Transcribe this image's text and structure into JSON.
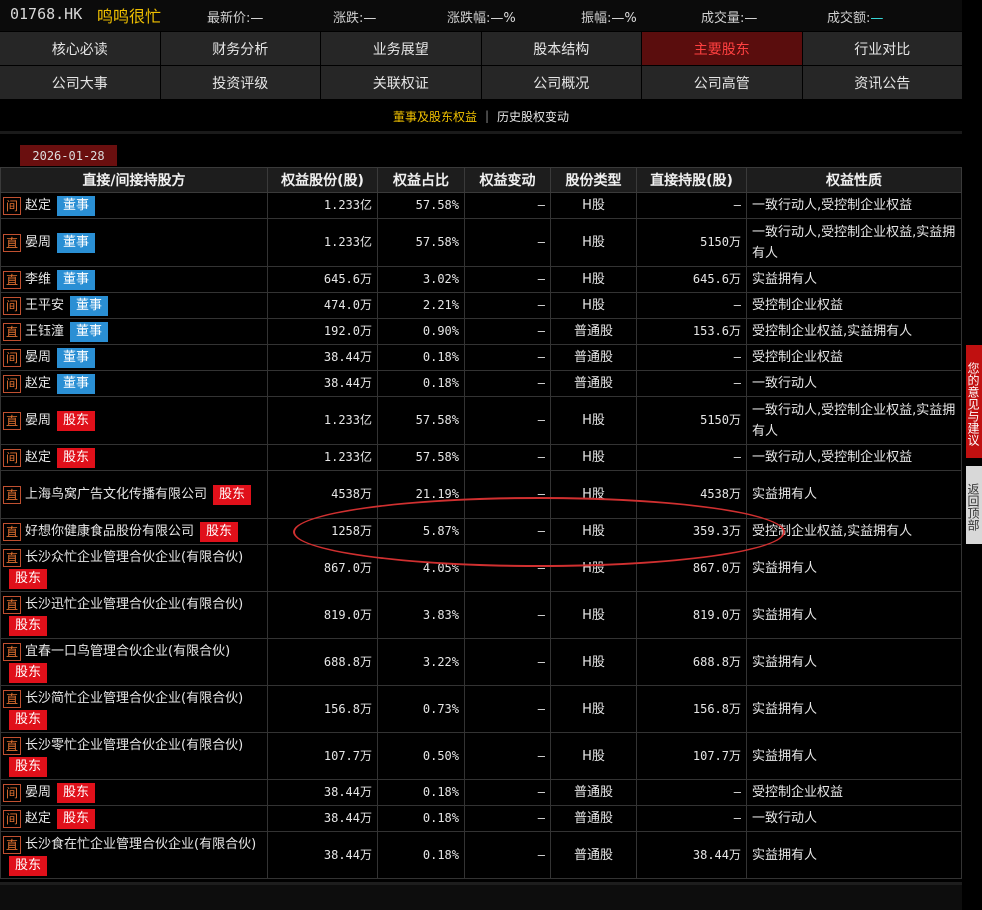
{
  "header": {
    "code": "01768.HK",
    "name": "鸣鸣很忙",
    "quotes": [
      {
        "label": "最新价:",
        "value": "—",
        "color": "#dddddd"
      },
      {
        "label": "涨跌:",
        "value": "—",
        "color": "#dddddd"
      },
      {
        "label": "涨跌幅:",
        "value": "—%",
        "color": "#dddddd"
      },
      {
        "label": "振幅:",
        "value": "—%",
        "color": "#dddddd"
      },
      {
        "label": "成交量:",
        "value": "—",
        "color": "#dddddd"
      },
      {
        "label": "成交额:",
        "value": "—",
        "color": "#39e0e0"
      }
    ]
  },
  "nav": {
    "row1": [
      "核心必读",
      "财务分析",
      "业务展望",
      "股本结构",
      "主要股东",
      "行业对比"
    ],
    "row2": [
      "公司大事",
      "投资评级",
      "关联权证",
      "公司概况",
      "公司高管",
      "资讯公告"
    ],
    "active": "主要股东"
  },
  "subnav": {
    "active": "董事及股东权益",
    "separator": "|",
    "other": "历史股权变动"
  },
  "date": "2026-01-28",
  "table": {
    "headers": [
      "直接/间接持股方",
      "权益股份(股)",
      "权益占比",
      "权益变动",
      "股份类型",
      "直接持股(股)",
      "权益性质"
    ],
    "rows": [
      {
        "flag": "间",
        "name": "赵定",
        "role": "董事",
        "role_type": "director",
        "shares": "1.233亿",
        "ratio": "57.58%",
        "change": "—",
        "type": "H股",
        "direct": "—",
        "nature": "一致行动人,受控制企业权益"
      },
      {
        "flag": "直",
        "name": "晏周",
        "role": "董事",
        "role_type": "director",
        "shares": "1.233亿",
        "ratio": "57.58%",
        "change": "—",
        "type": "H股",
        "direct": "5150万",
        "nature": "一致行动人,受控制企业权益,实益拥有人"
      },
      {
        "flag": "直",
        "name": "李维",
        "role": "董事",
        "role_type": "director",
        "shares": "645.6万",
        "ratio": "3.02%",
        "change": "—",
        "type": "H股",
        "direct": "645.6万",
        "nature": "实益拥有人"
      },
      {
        "flag": "间",
        "name": "王平安",
        "role": "董事",
        "role_type": "director",
        "shares": "474.0万",
        "ratio": "2.21%",
        "change": "—",
        "type": "H股",
        "direct": "—",
        "nature": "受控制企业权益"
      },
      {
        "flag": "直",
        "name": "王钰潼",
        "role": "董事",
        "role_type": "director",
        "shares": "192.0万",
        "ratio": "0.90%",
        "change": "—",
        "type": "普通股",
        "direct": "153.6万",
        "nature": "受控制企业权益,实益拥有人"
      },
      {
        "flag": "间",
        "name": "晏周",
        "role": "董事",
        "role_type": "director",
        "shares": "38.44万",
        "ratio": "0.18%",
        "change": "—",
        "type": "普通股",
        "direct": "—",
        "nature": "受控制企业权益"
      },
      {
        "flag": "间",
        "name": "赵定",
        "role": "董事",
        "role_type": "director",
        "shares": "38.44万",
        "ratio": "0.18%",
        "change": "—",
        "type": "普通股",
        "direct": "—",
        "nature": "一致行动人"
      },
      {
        "flag": "直",
        "name": "晏周",
        "role": "股东",
        "role_type": "shareholder",
        "shares": "1.233亿",
        "ratio": "57.58%",
        "change": "—",
        "type": "H股",
        "direct": "5150万",
        "nature": "一致行动人,受控制企业权益,实益拥有人"
      },
      {
        "flag": "间",
        "name": "赵定",
        "role": "股东",
        "role_type": "shareholder",
        "shares": "1.233亿",
        "ratio": "57.58%",
        "change": "—",
        "type": "H股",
        "direct": "—",
        "nature": "一致行动人,受控制企业权益"
      },
      {
        "flag": "直",
        "name": "上海鸟窝广告文化传播有限公司",
        "role": "股东",
        "role_type": "shareholder",
        "shares": "4538万",
        "ratio": "21.19%",
        "change": "—",
        "type": "H股",
        "direct": "4538万",
        "nature": "实益拥有人"
      },
      {
        "flag": "直",
        "name": "好想你健康食品股份有限公司",
        "role": "股东",
        "role_type": "shareholder",
        "shares": "1258万",
        "ratio": "5.87%",
        "change": "—",
        "type": "H股",
        "direct": "359.3万",
        "nature": "受控制企业权益,实益拥有人"
      },
      {
        "flag": "直",
        "name": "长沙众忙企业管理合伙企业(有限合伙)",
        "role": "股东",
        "role_type": "shareholder",
        "shares": "867.0万",
        "ratio": "4.05%",
        "change": "—",
        "type": "H股",
        "direct": "867.0万",
        "nature": "实益拥有人"
      },
      {
        "flag": "直",
        "name": "长沙迅忙企业管理合伙企业(有限合伙)",
        "role": "股东",
        "role_type": "shareholder",
        "shares": "819.0万",
        "ratio": "3.83%",
        "change": "—",
        "type": "H股",
        "direct": "819.0万",
        "nature": "实益拥有人"
      },
      {
        "flag": "直",
        "name": "宜春一口鸟管理合伙企业(有限合伙)",
        "role": "股东",
        "role_type": "shareholder",
        "shares": "688.8万",
        "ratio": "3.22%",
        "change": "—",
        "type": "H股",
        "direct": "688.8万",
        "nature": "实益拥有人"
      },
      {
        "flag": "直",
        "name": "长沙简忙企业管理合伙企业(有限合伙)",
        "role": "股东",
        "role_type": "shareholder",
        "shares": "156.8万",
        "ratio": "0.73%",
        "change": "—",
        "type": "H股",
        "direct": "156.8万",
        "nature": "实益拥有人"
      },
      {
        "flag": "直",
        "name": "长沙零忙企业管理合伙企业(有限合伙)",
        "role": "股东",
        "role_type": "shareholder",
        "shares": "107.7万",
        "ratio": "0.50%",
        "change": "—",
        "type": "H股",
        "direct": "107.7万",
        "nature": "实益拥有人"
      },
      {
        "flag": "间",
        "name": "晏周",
        "role": "股东",
        "role_type": "shareholder",
        "shares": "38.44万",
        "ratio": "0.18%",
        "change": "—",
        "type": "普通股",
        "direct": "—",
        "nature": "受控制企业权益"
      },
      {
        "flag": "间",
        "name": "赵定",
        "role": "股东",
        "role_type": "shareholder",
        "shares": "38.44万",
        "ratio": "0.18%",
        "change": "—",
        "type": "普通股",
        "direct": "—",
        "nature": "一致行动人"
      },
      {
        "flag": "直",
        "name": "长沙食在忙企业管理合伙企业(有限合伙)",
        "role": "股东",
        "role_type": "shareholder",
        "shares": "38.44万",
        "ratio": "0.18%",
        "change": "—",
        "type": "普通股",
        "direct": "38.44万",
        "nature": "实益拥有人"
      }
    ]
  },
  "side": {
    "feedback": "您的意见与建议",
    "backtop": "返回顶部"
  }
}
